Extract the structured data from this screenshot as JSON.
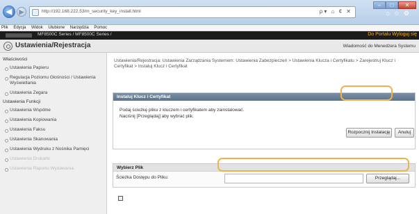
{
  "browser": {
    "url": "http://192.168.222.53/m_security_key_install.html",
    "address_tools": "ρ▾ ⌂ ¢ ✕",
    "menu": [
      "Plik",
      "Edycja",
      "Widok",
      "Ulubione",
      "Narzędzia",
      "Pomoc"
    ]
  },
  "app_header": {
    "product": "MF8500C Series / MF8500C Series /",
    "portal_link": "Do Portalu",
    "logout_link": "Wyloguj się"
  },
  "page_header": {
    "title": "Ustawienia/Rejestracja",
    "message_link": "Wiadomość do Menedżera Systemu"
  },
  "sidebar": {
    "section1": "Właściwości",
    "items1": [
      "Ustawienia Papieru",
      "Regulacja Poziomu Głośności / Ustawienia Wyświetlania",
      "Ustawienia Zegara"
    ],
    "section2": "Ustawienia Funkcji",
    "items2": [
      "Ustawienia Wspólne",
      "Ustawienia Kopiowania",
      "Ustawienia Faksu",
      "Ustawienia Skanowania",
      "Ustawienia Wydruku z Nośnika Pamięci",
      "Ustawienia Drukarki",
      "Ustawienia Raportu Wydawania"
    ]
  },
  "main": {
    "breadcrumb": "Ustawienia/Rejestracja: Ustawienia Zarządzania Systemem: Ustawienia Zabezpieczeń > Ustawienia Klucza i Certyfikatu > Zarejestruj Klucz i Certyfikat > Instaluj Klucz i Certyfikat",
    "install_panel": {
      "title": "Instaluj Klucz i Certyfikat",
      "line1": "Podaj ścieżkę pliku z kluczem i certyfikatem aby zainstalować.",
      "line2": "Naciśnij [Przeglądaj] aby wybrać plik.",
      "start_button": "Rozpocznij Instalację",
      "cancel_button": "Anuluj"
    },
    "file_panel": {
      "title": "Wybierz Plik",
      "path_label": "Ścieżka Dostępu do Pliku:",
      "browse_button": "Przeglądaj..."
    }
  }
}
